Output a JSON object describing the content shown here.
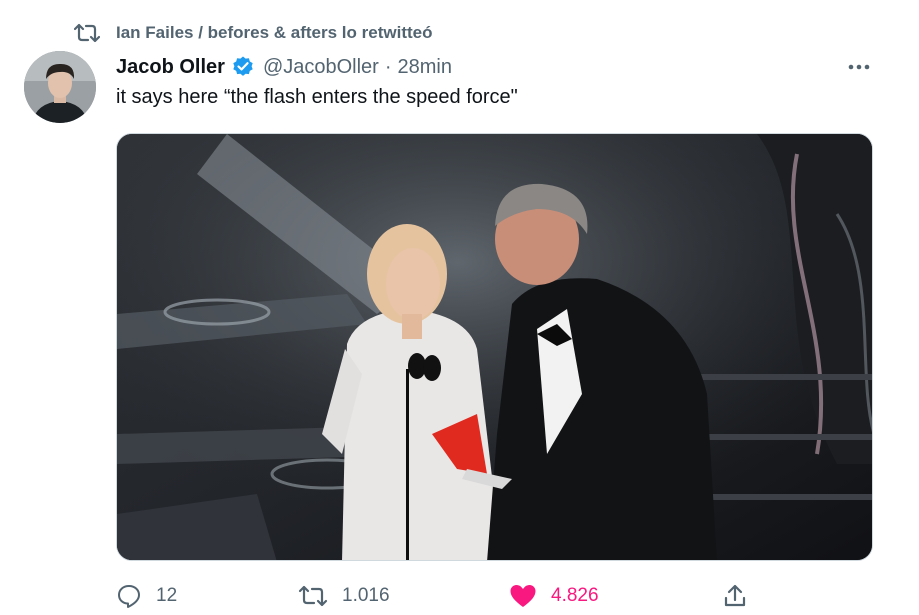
{
  "retweet_banner": {
    "icon": "retweet-icon",
    "text": "Ian Failes / befores & afters lo retwitteó"
  },
  "tweet": {
    "author": {
      "display_name": "Jacob Oller",
      "verified": true,
      "handle": "@JacobOller",
      "avatar": "avatar-photo"
    },
    "separator": "·",
    "time": "28min",
    "text": "it says here “the flash enters the speed force\"",
    "media": {
      "type": "photo",
      "description_icon": "photo"
    }
  },
  "actions": {
    "reply": {
      "icon": "reply-icon",
      "count": "12"
    },
    "retweet": {
      "icon": "retweet-icon",
      "count": "1.016"
    },
    "like": {
      "icon": "heart-icon",
      "count": "4.826",
      "liked": true
    },
    "share": {
      "icon": "share-icon"
    }
  },
  "colors": {
    "secondary_text": "#536471",
    "verified_blue": "#1d9bf0",
    "like_pink": "#f91880"
  }
}
